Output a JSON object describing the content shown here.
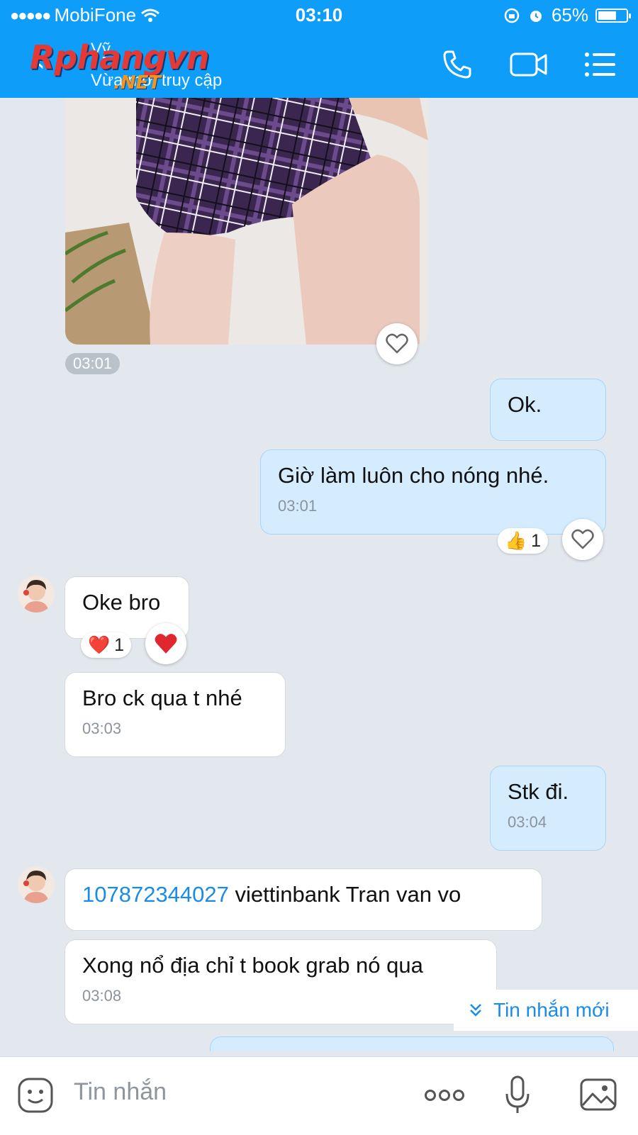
{
  "status_bar": {
    "signal": "●●●●●",
    "carrier": "MobiFone",
    "time": "03:10",
    "battery": "65%",
    "battery_level": 0.65
  },
  "header": {
    "name": "Vỹ",
    "subtitle": "Vừa mới truy cập",
    "watermark_text": "Rphangvn",
    "watermark_sub": ".NET"
  },
  "messages": {
    "photo_time": "03:01",
    "out_1": {
      "text": "Ok."
    },
    "out_2": {
      "text": "Giờ làm luôn cho nóng nhé.",
      "time": "03:01",
      "reaction_emoji": "👍",
      "reaction_count": "1"
    },
    "in_1": {
      "text": "Oke bro",
      "reaction_emoji": "❤️",
      "reaction_count": "1"
    },
    "in_2": {
      "text": "Bro ck qua t nhé",
      "time": "03:03"
    },
    "out_3": {
      "text": "Stk đi.",
      "time": "03:04"
    },
    "in_3": {
      "account_number": "107872344027",
      "text": " viettinbank Tran van vo"
    },
    "in_4": {
      "text": "Xong nổ địa chỉ t book grab nó qua",
      "time": "03:08"
    }
  },
  "new_messages_label": "Tin nhắn mới",
  "input": {
    "placeholder": "Tin nhắn"
  },
  "colors": {
    "header_bg": "#0e9df8",
    "chat_bg": "#e3e8ef",
    "out_bubble": "#d4ecfd",
    "link": "#1a8ce8"
  }
}
